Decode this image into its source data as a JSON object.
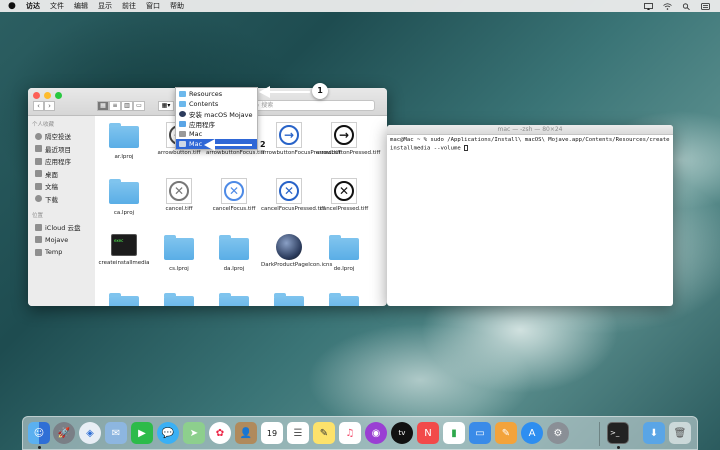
{
  "menubar": {
    "app": "访达",
    "items": [
      "文件",
      "编辑",
      "显示",
      "前往",
      "窗口",
      "帮助"
    ]
  },
  "finder": {
    "search_placeholder": "搜索",
    "sidebar": {
      "favorites_heading": "个人收藏",
      "favorites": [
        "隔空投送",
        "最近项目",
        "应用程序",
        "桌面",
        "文稿",
        "下载"
      ],
      "locations_heading": "位置",
      "locations": [
        "iCloud 云盘",
        "Mojave",
        "Temp"
      ]
    },
    "files": [
      {
        "name": "ar.lproj",
        "kind": "folder"
      },
      {
        "name": "arrowbutton.tiff",
        "kind": "tiff"
      },
      {
        "name": "arrowbuttonFocus.tiff",
        "kind": "tiff"
      },
      {
        "name": "arrowbuttonFocusPressed.tiff",
        "kind": "tiff"
      },
      {
        "name": "arrowbuttonPressed.tiff",
        "kind": "tiff"
      },
      {
        "name": "ca.lproj",
        "kind": "folder"
      },
      {
        "name": "cancel.tiff",
        "kind": "tiff"
      },
      {
        "name": "cancelFocus.tiff",
        "kind": "tiff"
      },
      {
        "name": "cancelFocusPressed.tiff",
        "kind": "tiff"
      },
      {
        "name": "cancelPressed.tiff",
        "kind": "tiff"
      },
      {
        "name": "createinstallmedia",
        "kind": "exec"
      },
      {
        "name": "cs.lproj",
        "kind": "folder"
      },
      {
        "name": "da.lproj",
        "kind": "folder"
      },
      {
        "name": "DarkProductPageIcon.icns",
        "kind": "icns"
      },
      {
        "name": "de.lproj",
        "kind": "folder"
      }
    ]
  },
  "path_dropdown": {
    "items": [
      "Resources",
      "Contents",
      "安装 macOS Mojave",
      "应用程序",
      "Mac",
      "Mac"
    ]
  },
  "terminal": {
    "title": "mac — -zsh — 80×24",
    "content": "mac@Mac ~ % sudo /Applications/Install\\ macOS\\ Mojave.app/Contents/Resources/createinstallmedia --volume "
  },
  "annotations": {
    "badge1": "1",
    "badge2": "2"
  },
  "dock": {
    "apps": [
      "finder-icon",
      "launchpad-icon",
      "safari-icon",
      "mail-icon",
      "facetime-icon",
      "messages-icon",
      "maps-icon",
      "photos-icon",
      "contacts-icon",
      "calendar-icon",
      "reminders-icon",
      "notes-icon",
      "music-icon",
      "podcasts-icon",
      "tv-icon",
      "news-icon",
      "numbers-icon",
      "keynote-icon",
      "pages-icon",
      "app-store-icon",
      "system-preferences-icon",
      "terminal-icon",
      "downloads-icon",
      "trash-icon"
    ],
    "calendar_day": "19"
  }
}
